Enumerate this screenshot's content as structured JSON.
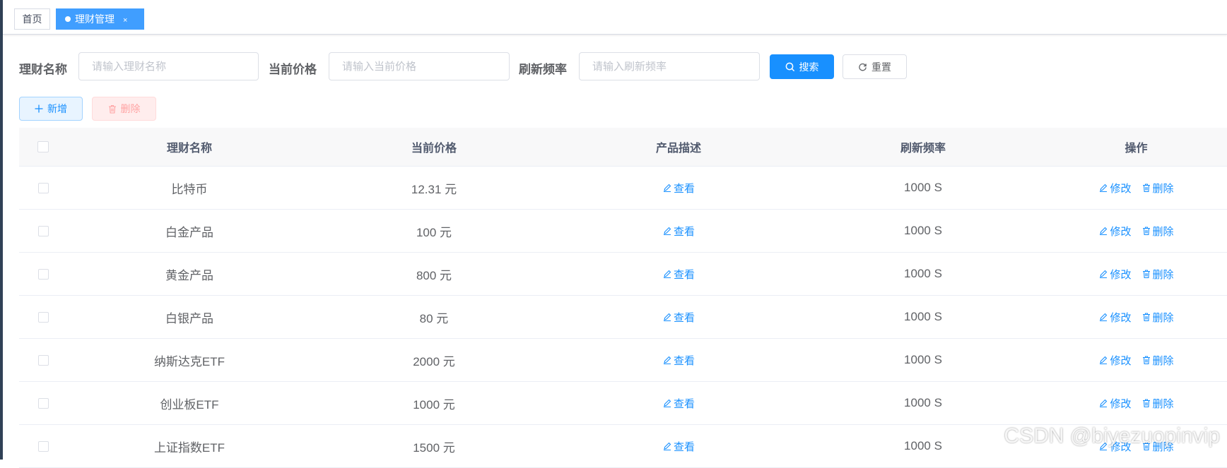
{
  "tags": {
    "home": "首页",
    "active": "理财管理",
    "close": "×"
  },
  "search": {
    "name_label": "理财名称",
    "name_placeholder": "请输入理财名称",
    "price_label": "当前价格",
    "price_placeholder": "请输入当前价格",
    "rate_label": "刷新频率",
    "rate_placeholder": "请输入刷新频率",
    "search_button": "搜索",
    "reset_button": "重置"
  },
  "toolbar": {
    "add_button": "新增",
    "delete_button": "删除"
  },
  "table": {
    "headers": {
      "name": "理财名称",
      "price": "当前价格",
      "desc": "产品描述",
      "rate": "刷新频率",
      "ops": "操作"
    },
    "view_label": "查看",
    "edit_label": "修改",
    "delete_label": "删除",
    "rows": [
      {
        "name": "比特币",
        "price": "12.31 元",
        "rate": "1000 S"
      },
      {
        "name": "白金产品",
        "price": "100 元",
        "rate": "1000 S"
      },
      {
        "name": "黄金产品",
        "price": "800 元",
        "rate": "1000 S"
      },
      {
        "name": "白银产品",
        "price": "80 元",
        "rate": "1000 S"
      },
      {
        "name": "纳斯达克ETF",
        "price": "2000 元",
        "rate": "1000 S"
      },
      {
        "name": "创业板ETF",
        "price": "1000 元",
        "rate": "1000 S"
      },
      {
        "name": "上证指数ETF",
        "price": "1500 元",
        "rate": "1000 S"
      }
    ]
  },
  "watermark": "CSDN @biyezuopinvip",
  "colors": {
    "primary": "#1890ff",
    "danger_light": "#ffa3a3",
    "sidebar": "#304156"
  }
}
